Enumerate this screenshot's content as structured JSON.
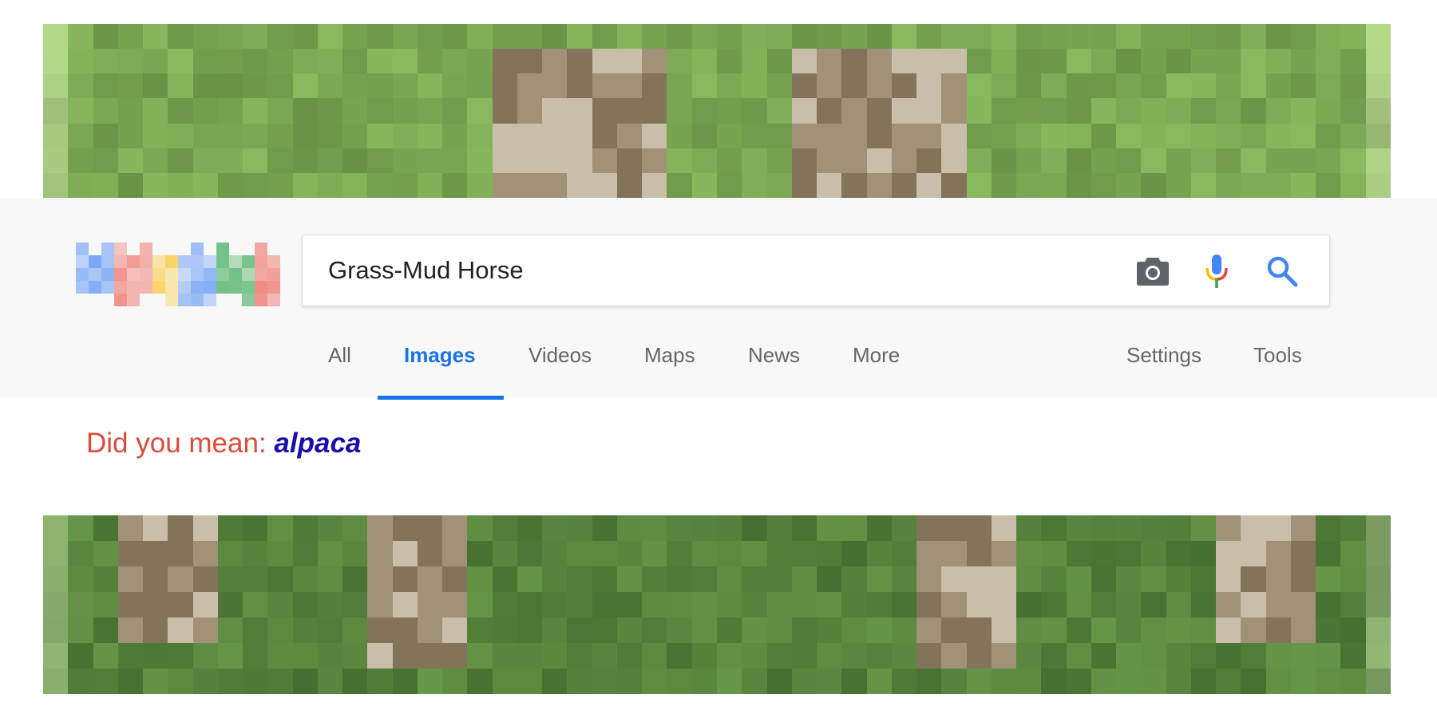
{
  "search": {
    "query": "Grass-Mud Horse",
    "icons": [
      "camera-icon",
      "microphone-icon",
      "search-icon"
    ]
  },
  "logo": {
    "text": "Google",
    "colors": [
      "#4285f4",
      "#ea4335",
      "#fbbc05",
      "#4285f4",
      "#34a853",
      "#ea4335"
    ]
  },
  "tabs": [
    {
      "label": "All",
      "active": false
    },
    {
      "label": "Images",
      "active": true
    },
    {
      "label": "Videos",
      "active": false
    },
    {
      "label": "Maps",
      "active": false
    },
    {
      "label": "News",
      "active": false
    },
    {
      "label": "More",
      "active": false
    }
  ],
  "tools": {
    "settings_label": "Settings",
    "tools_label": "Tools"
  },
  "spelling": {
    "prompt": "Did you mean:",
    "suggestion": "alpaca"
  },
  "colors": {
    "accent": "#1a73e8",
    "suggestion_label": "#dd4b39",
    "suggestion_link": "#1a0dab",
    "header_bg": "#f8f8f8",
    "grass": "#7aa653"
  }
}
